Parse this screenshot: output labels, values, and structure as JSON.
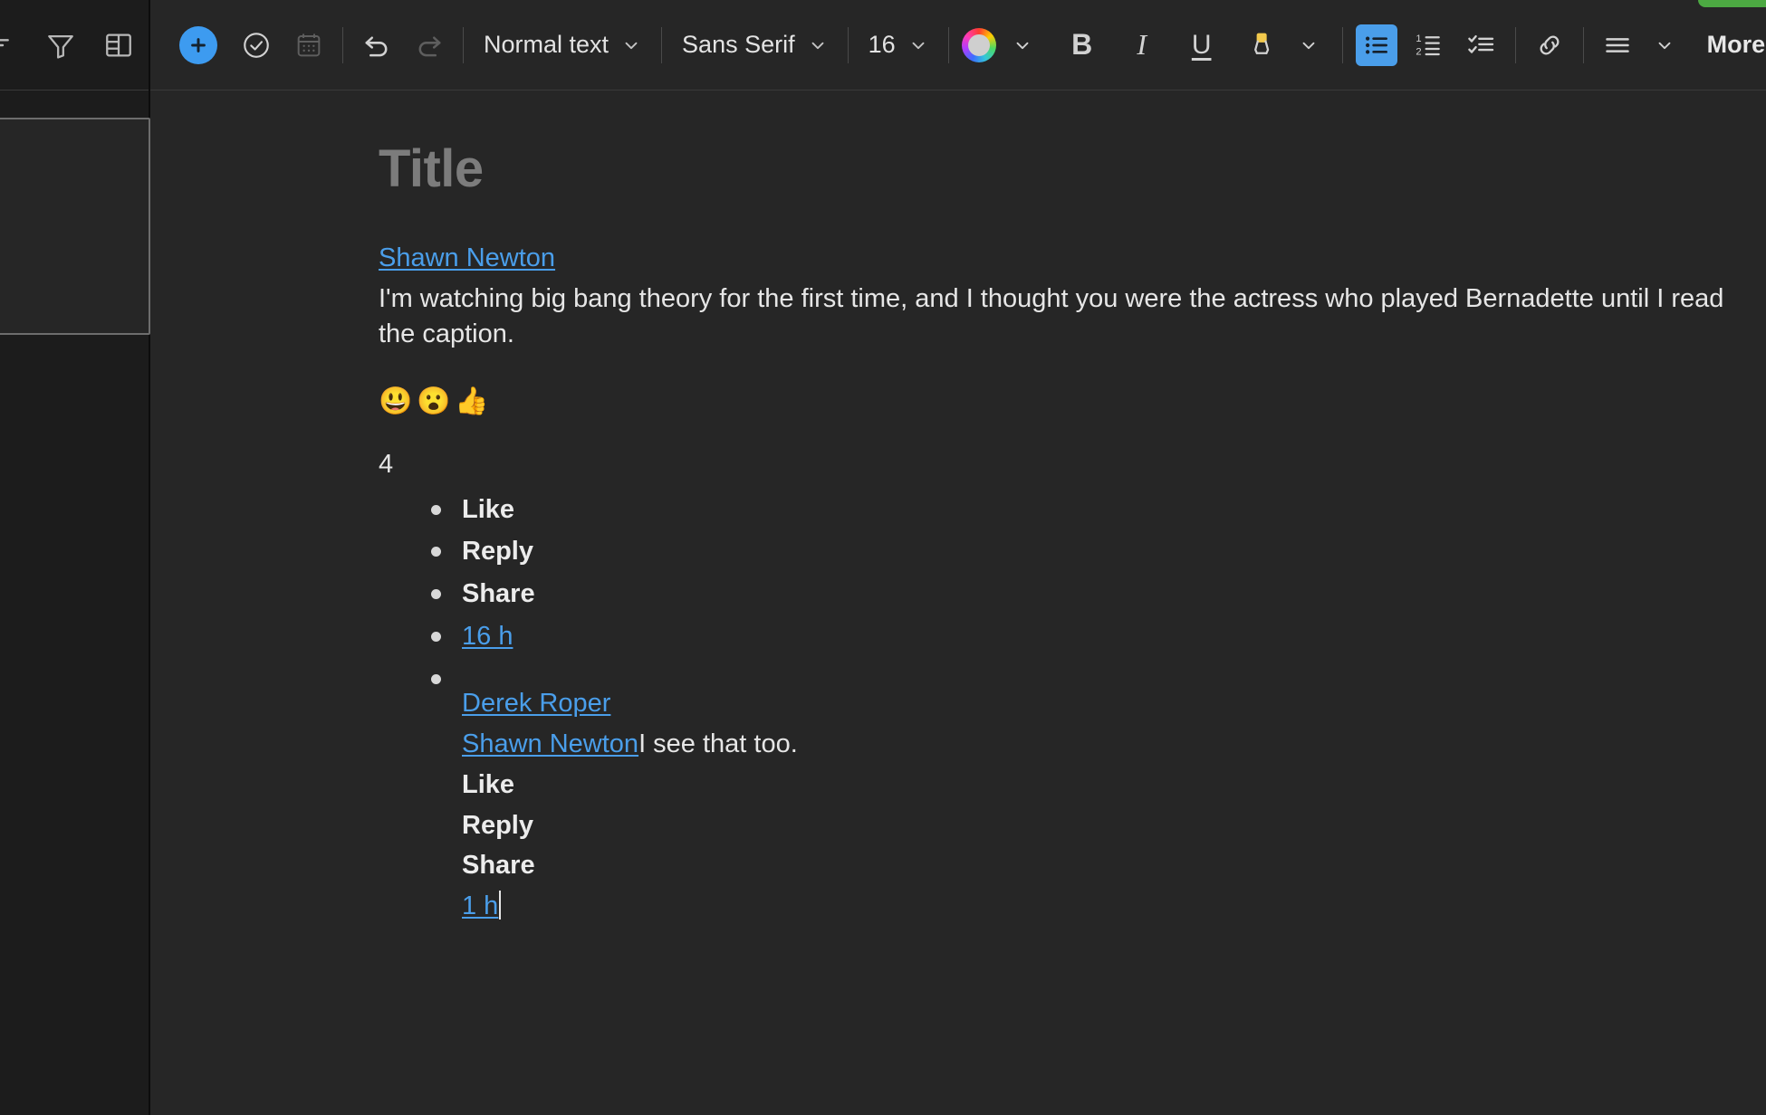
{
  "window": {
    "background_color": "#262626",
    "sidebar_color": "#1c1c1c",
    "accent_blue": "#4a9eea",
    "link_blue": "#4a9eea",
    "green_button_color": "#4CA942"
  },
  "sidebar": {
    "icons": [
      {
        "name": "sort-lines-icon",
        "label": "Sort"
      },
      {
        "name": "filter-funnel-icon",
        "label": "Filter"
      },
      {
        "name": "table-layout-icon",
        "label": "Layout"
      }
    ],
    "card": {
      "name": "empty-panel-card",
      "label": ""
    }
  },
  "toolbar": {
    "add_button": {
      "name": "add-button",
      "icon": "plus-icon",
      "label": ""
    },
    "task_button": {
      "name": "task-check-button",
      "icon": "circle-check-icon",
      "label": ""
    },
    "calendar_button": {
      "name": "calendar-button",
      "icon": "calendar-icon",
      "label": "",
      "disabled": true
    },
    "undo_button": {
      "name": "undo-button",
      "icon": "undo-arrow-icon",
      "label": ""
    },
    "redo_button": {
      "name": "redo-button",
      "icon": "redo-arrow-icon",
      "label": "",
      "disabled": true
    },
    "paragraph_style": {
      "label": "Normal text"
    },
    "font_family": {
      "label": "Sans Serif"
    },
    "font_size": {
      "label": "16"
    },
    "text_color": {
      "name": "text-color-picker",
      "label": ""
    },
    "bold": {
      "label": "B"
    },
    "italic": {
      "label": "I"
    },
    "underline": {
      "label": "U"
    },
    "highlight": {
      "name": "highlighter-icon",
      "label": ""
    },
    "bulleted_list": {
      "name": "bulleted-list-button",
      "label": "",
      "active": true
    },
    "numbered_list": {
      "name": "numbered-list-button",
      "label": ""
    },
    "checklist": {
      "name": "checklist-button",
      "label": ""
    },
    "link": {
      "name": "link-button",
      "label": ""
    },
    "align": {
      "name": "align-button",
      "label": ""
    },
    "more": {
      "label": "More"
    }
  },
  "document": {
    "title_placeholder": "Title",
    "author": "Shawn Newton",
    "body": "I'm watching big bang theory for the first time, and I thought you were the actress who played Bernadette until I read the caption.",
    "reactions": [
      {
        "name": "haha-emoji",
        "glyph": "😃"
      },
      {
        "name": "wow-emoji",
        "glyph": "😮"
      },
      {
        "name": "like-thumbs-up-emoji",
        "glyph": "👍"
      }
    ],
    "reaction_count": "4",
    "actions": [
      {
        "label": "Like",
        "style": "bold",
        "link": false
      },
      {
        "label": "Reply",
        "style": "bold",
        "link": false
      },
      {
        "label": "Share",
        "style": "bold",
        "link": false
      },
      {
        "label": "16 h",
        "style": "normal",
        "link": true
      },
      {
        "label": "",
        "style": "normal",
        "link": false
      }
    ],
    "reply": {
      "author": "Derek Roper",
      "mention": "Shawn Newton",
      "text": "I see that too.",
      "actions": [
        {
          "label": "Like",
          "link": false
        },
        {
          "label": "Reply",
          "link": false
        },
        {
          "label": "Share",
          "link": false
        },
        {
          "label": "1 h",
          "link": true
        }
      ]
    }
  }
}
